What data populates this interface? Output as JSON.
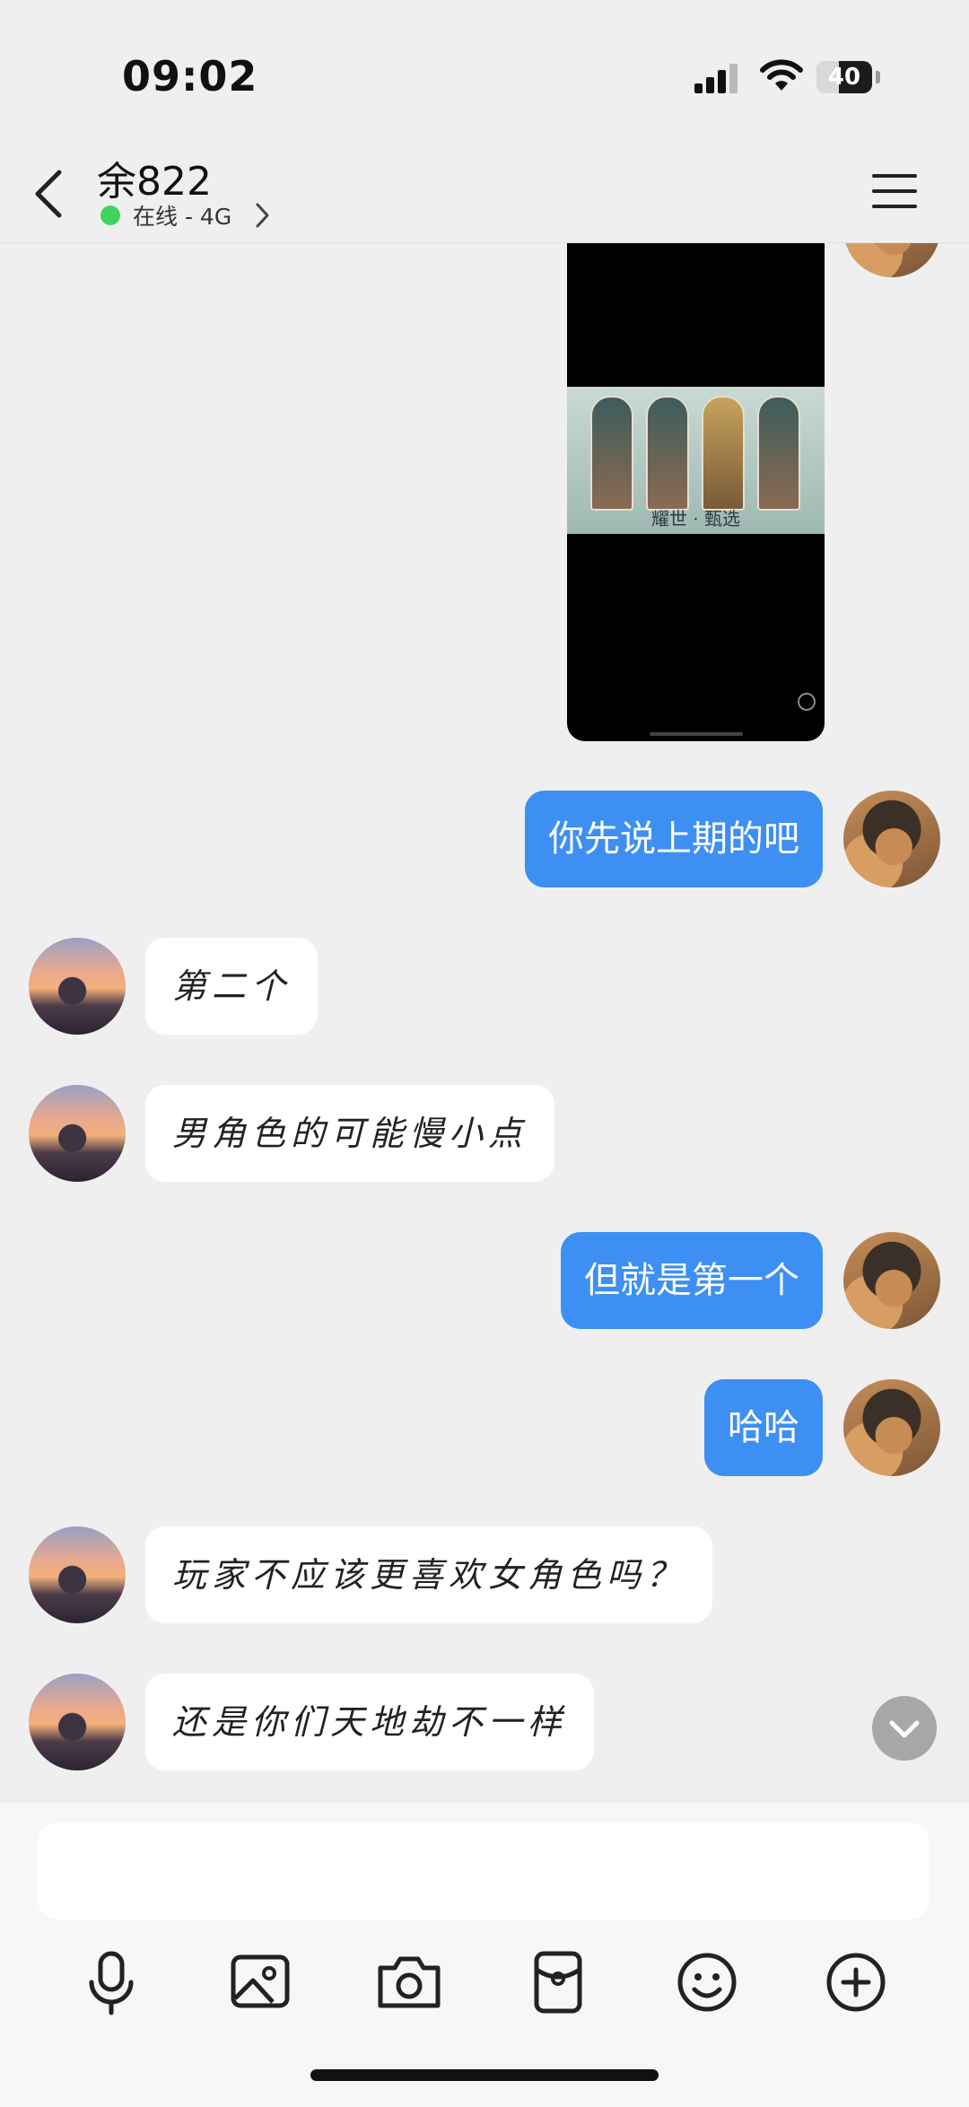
{
  "status_bar": {
    "time": "09:02",
    "battery": "40",
    "battery_level": 0.4
  },
  "header": {
    "name": "余822",
    "status": "在线 - 4G"
  },
  "image_message": {
    "caption": "耀世 · 甄选"
  },
  "messages": [
    {
      "side": "right",
      "text": "你先说上期的吧"
    },
    {
      "side": "left",
      "text": "第二个"
    },
    {
      "side": "left",
      "text": "男角色的可能慢小点"
    },
    {
      "side": "right",
      "text": "但就是第一个"
    },
    {
      "side": "right",
      "text": "哈哈"
    },
    {
      "side": "left",
      "text": "玩家不应该更喜欢女角色吗？"
    },
    {
      "side": "left",
      "text": "还是你们天地劫不一样"
    }
  ],
  "input": {
    "value": "",
    "placeholder": ""
  },
  "toolbar": [
    "microphone-icon",
    "image-icon",
    "camera-icon",
    "red-packet-icon",
    "emoji-icon",
    "plus-icon"
  ],
  "colors": {
    "bubble_self": "#3d8ff3",
    "bubble_other": "#ffffff",
    "background": "#efefef",
    "online": "#41d35a"
  }
}
